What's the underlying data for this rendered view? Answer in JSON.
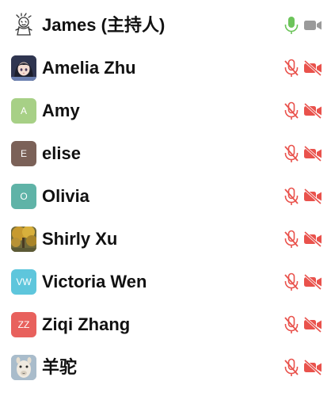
{
  "colors": {
    "muted_red": "#e9524c",
    "mic_on_green": "#6cc45a",
    "cam_gray": "#9a9a9a",
    "name_text": "#111111"
  },
  "participants": [
    {
      "name": "James (主持人)",
      "avatar_type": "drawing",
      "mic": "on",
      "camera": "off-gray"
    },
    {
      "name": "Amelia Zhu",
      "avatar_type": "photo-anime",
      "mic": "muted",
      "camera": "off"
    },
    {
      "name": "Amy",
      "avatar_type": "initial",
      "initial": "A",
      "avatar_color": "#a7d086",
      "mic": "muted",
      "camera": "off"
    },
    {
      "name": "elise",
      "avatar_type": "initial",
      "initial": "E",
      "avatar_color": "#7b6158",
      "mic": "muted",
      "camera": "off"
    },
    {
      "name": "Olivia",
      "avatar_type": "initial",
      "initial": "O",
      "avatar_color": "#5fb3a7",
      "mic": "muted",
      "camera": "off"
    },
    {
      "name": "Shirly Xu",
      "avatar_type": "photo-autumn",
      "mic": "muted",
      "camera": "off"
    },
    {
      "name": "Victoria Wen",
      "avatar_type": "initial",
      "initial": "VW",
      "avatar_color": "#5ec6dc",
      "mic": "muted",
      "camera": "off"
    },
    {
      "name": "Ziqi Zhang",
      "avatar_type": "initial",
      "initial": "ZZ",
      "avatar_color": "#e8615d",
      "mic": "muted",
      "camera": "off"
    },
    {
      "name": "羊驼",
      "avatar_type": "photo-alpaca",
      "mic": "muted",
      "camera": "off"
    }
  ],
  "icons": {
    "mic_on": "microphone-icon",
    "mic_muted": "microphone-muted-icon",
    "camera_off": "camera-off-icon",
    "camera_gray": "camera-icon"
  }
}
